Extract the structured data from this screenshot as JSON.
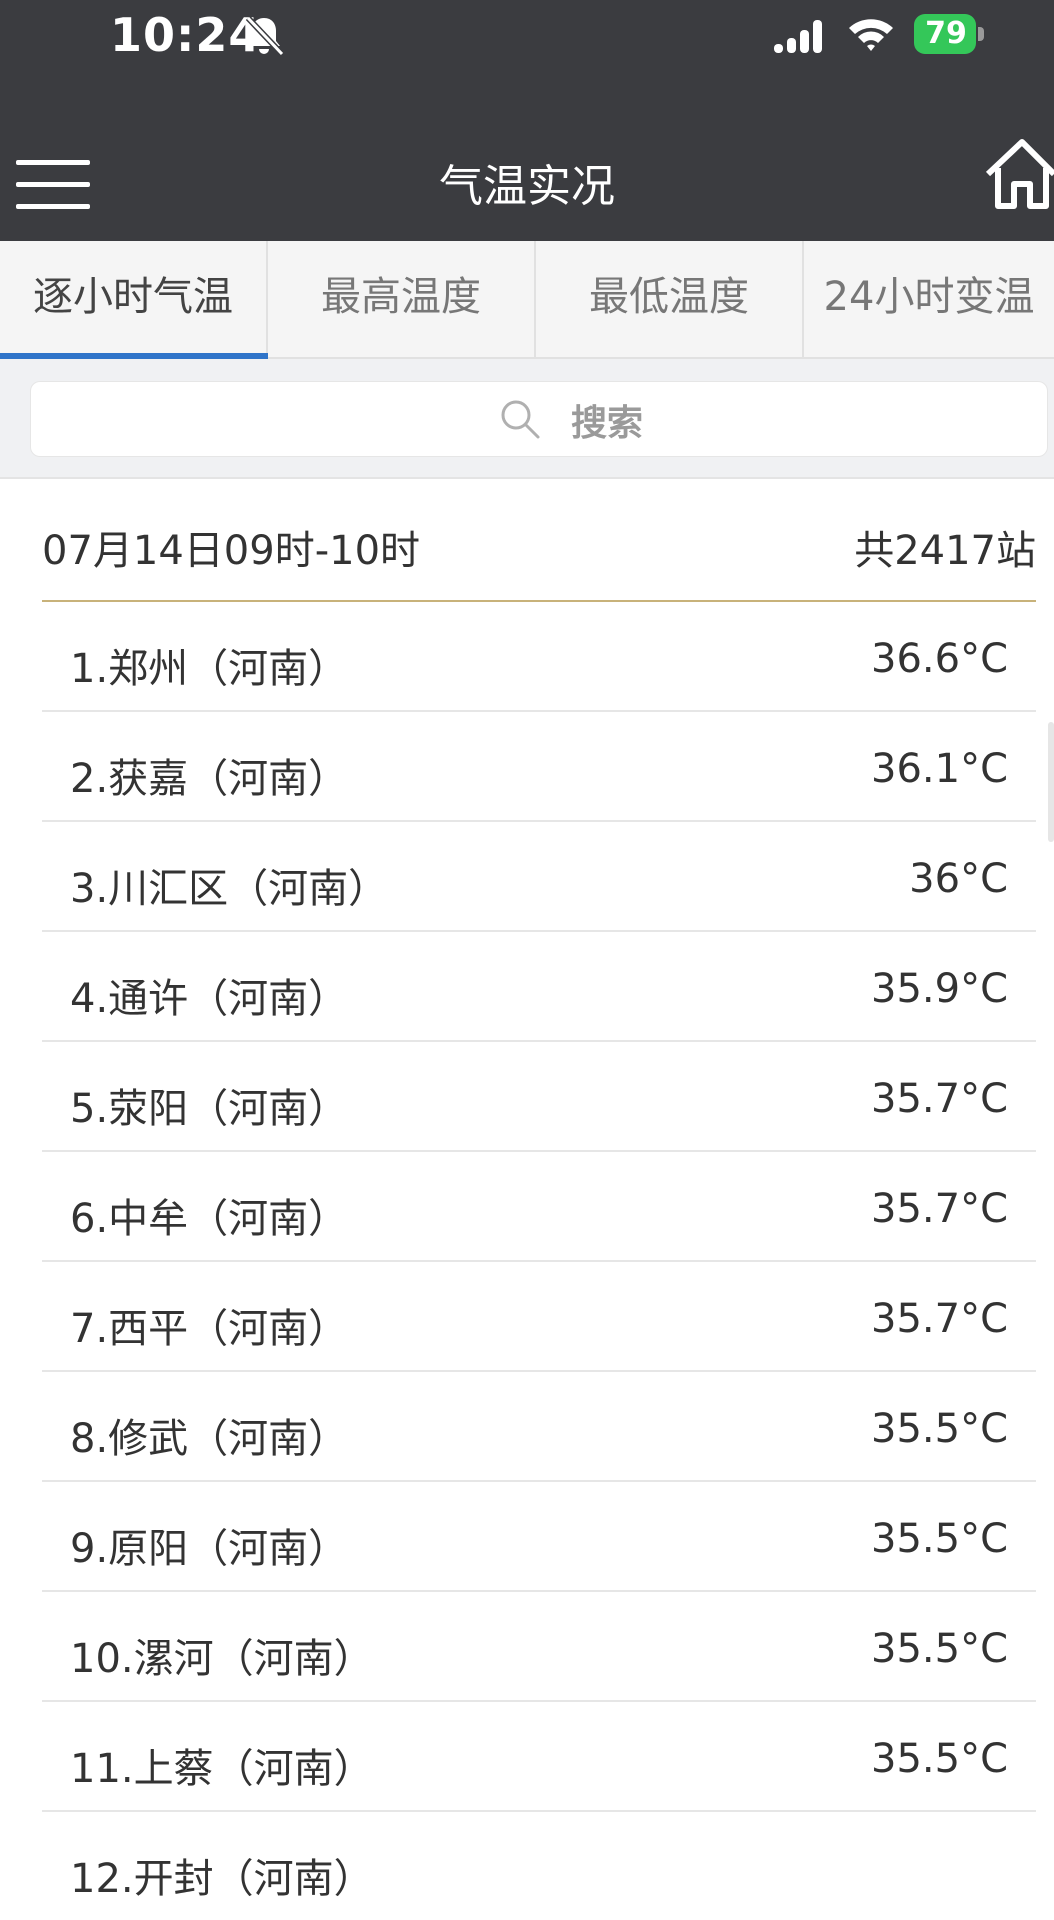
{
  "status_bar": {
    "time": "10:24",
    "battery": "79"
  },
  "header": {
    "title": "气温实况"
  },
  "tabs": [
    {
      "label": "逐小时气温",
      "active": true
    },
    {
      "label": "最高温度",
      "active": false
    },
    {
      "label": "最低温度",
      "active": false
    },
    {
      "label": "24小时变温",
      "active": false
    }
  ],
  "search": {
    "label": "搜索"
  },
  "list_header": {
    "date_range": "07月14日09时-10时",
    "station_count": "共2417站"
  },
  "stations": [
    {
      "name": "1.郑州（河南）",
      "temp": "36.6°C"
    },
    {
      "name": "2.获嘉（河南）",
      "temp": "36.1°C"
    },
    {
      "name": "3.川汇区（河南）",
      "temp": "36°C"
    },
    {
      "name": "4.通许（河南）",
      "temp": "35.9°C"
    },
    {
      "name": "5.荥阳（河南）",
      "temp": "35.7°C"
    },
    {
      "name": "6.中牟（河南）",
      "temp": "35.7°C"
    },
    {
      "name": "7.西平（河南）",
      "temp": "35.7°C"
    },
    {
      "name": "8.修武（河南）",
      "temp": "35.5°C"
    },
    {
      "name": "9.原阳（河南）",
      "temp": "35.5°C"
    },
    {
      "name": "10.漯河（河南）",
      "temp": "35.5°C"
    },
    {
      "name": "11.上蔡（河南）",
      "temp": "35.5°C"
    },
    {
      "name": "12.开封（河南）",
      "temp": ""
    }
  ],
  "colors": {
    "header_bg": "#3b3c40",
    "tab_indicator": "#2f74c9",
    "header_divider": "#c8b27a",
    "battery": "#34c759"
  }
}
